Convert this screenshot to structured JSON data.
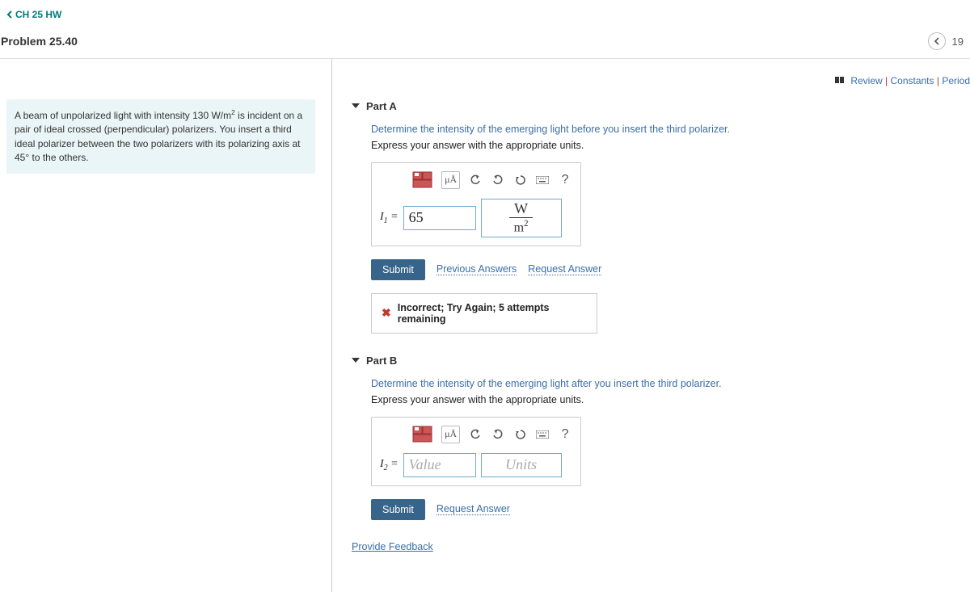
{
  "nav": {
    "chapter_link": "CH 25 HW"
  },
  "problem": {
    "title": "Problem 25.40",
    "counter": "19"
  },
  "top_links": {
    "review": "Review",
    "constants": "Constants",
    "periodic": "Period"
  },
  "prompt": {
    "pre": "A beam of unpolarized light with intensity 130 ",
    "unit_html": "W/m²",
    "post": " is incident on a pair of ideal crossed (perpendicular) polarizers. You insert a third ideal polarizer between the two polarizers with its polarizing axis at 45° to the others."
  },
  "partA": {
    "label": "Part A",
    "instr1": "Determine the intensity of the emerging light before you insert the third polarizer.",
    "instr2": "Express your answer with the appropriate units.",
    "toolbar": {
      "mu": "μÅ",
      "help": "?"
    },
    "var": "I₁ =",
    "value": "65",
    "unit_num": "W",
    "unit_den": "m²",
    "submit": "Submit",
    "prev_answers": "Previous Answers",
    "request_answer": "Request Answer",
    "feedback": "Incorrect; Try Again; 5 attempts remaining"
  },
  "partB": {
    "label": "Part B",
    "instr1": "Determine the intensity of the emerging light after you insert the third polarizer.",
    "instr2": "Express your answer with the appropriate units.",
    "toolbar": {
      "mu": "μÅ",
      "help": "?"
    },
    "var": "I₂ =",
    "value_placeholder": "Value",
    "units_placeholder": "Units",
    "submit": "Submit",
    "request_answer": "Request Answer"
  },
  "footer": {
    "provide_feedback": "Provide Feedback"
  }
}
